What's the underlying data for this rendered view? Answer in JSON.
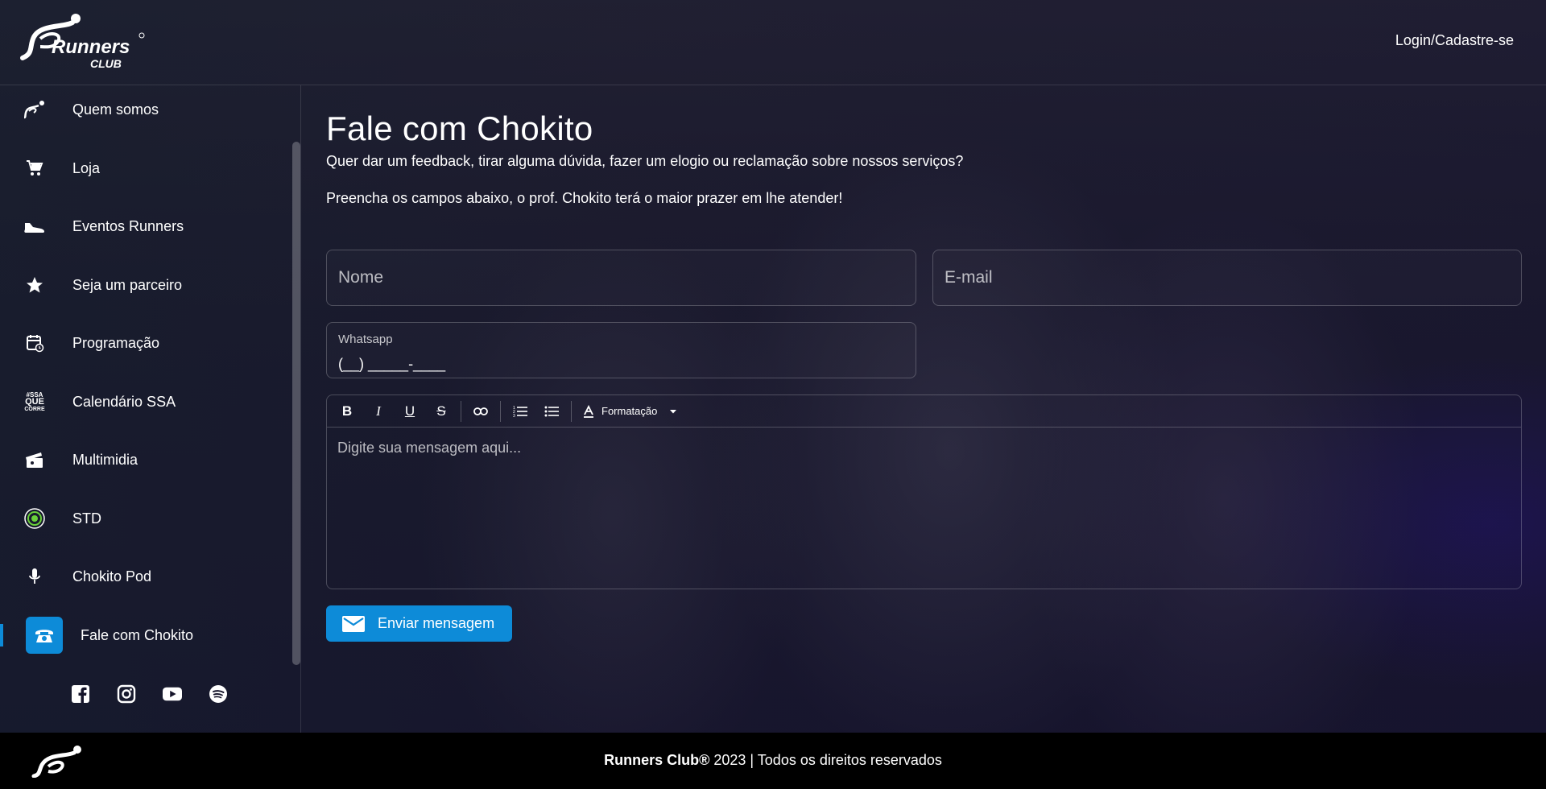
{
  "header": {
    "brand_line1": "Runners",
    "brand_line2": "CLUB",
    "login_label": "Login/Cadastre-se"
  },
  "sidebar": {
    "items": [
      {
        "label": "Quem somos",
        "icon": "runner-logo-icon"
      },
      {
        "label": "Loja",
        "icon": "cart-icon"
      },
      {
        "label": "Eventos Runners",
        "icon": "sneaker-icon"
      },
      {
        "label": "Seja um parceiro",
        "icon": "star-icon"
      },
      {
        "label": "Programação",
        "icon": "calendar-icon"
      },
      {
        "label": "Calendário SSA",
        "icon": "ssa-que-corre-icon"
      },
      {
        "label": "Multimidia",
        "icon": "clapperboard-icon"
      },
      {
        "label": "STD",
        "icon": "std-target-icon"
      },
      {
        "label": "Chokito Pod",
        "icon": "microphone-icon"
      },
      {
        "label": "Fale com Chokito",
        "icon": "telephone-icon",
        "active": true
      }
    ],
    "ssa_icon_text": [
      "#SSA",
      "QUE",
      "CORRE"
    ],
    "social": [
      "facebook-icon",
      "instagram-icon",
      "youtube-icon",
      "spotify-icon"
    ]
  },
  "main": {
    "title": "Fale com Chokito",
    "subtitle": "Quer dar um feedback, tirar alguma dúvida, fazer um elogio ou reclamação sobre nossos serviços?",
    "instructions": "Preencha os campos abaixo, o prof. Chokito terá o maior prazer em lhe atender!",
    "form": {
      "name_placeholder": "Nome",
      "email_placeholder": "E-mail",
      "whatsapp_label": "Whatsapp",
      "whatsapp_value": "(__) _____-____",
      "message_placeholder": "Digite sua mensagem aqui...",
      "format_label": "Formatação",
      "send_label": "Enviar mensagem"
    }
  },
  "footer": {
    "brand": "Runners Club®",
    "year": "2023",
    "divider": "|",
    "rights": "Todos os direitos reservados"
  },
  "colors": {
    "accent": "#0d8bd8",
    "footer_bg": "#000000"
  }
}
